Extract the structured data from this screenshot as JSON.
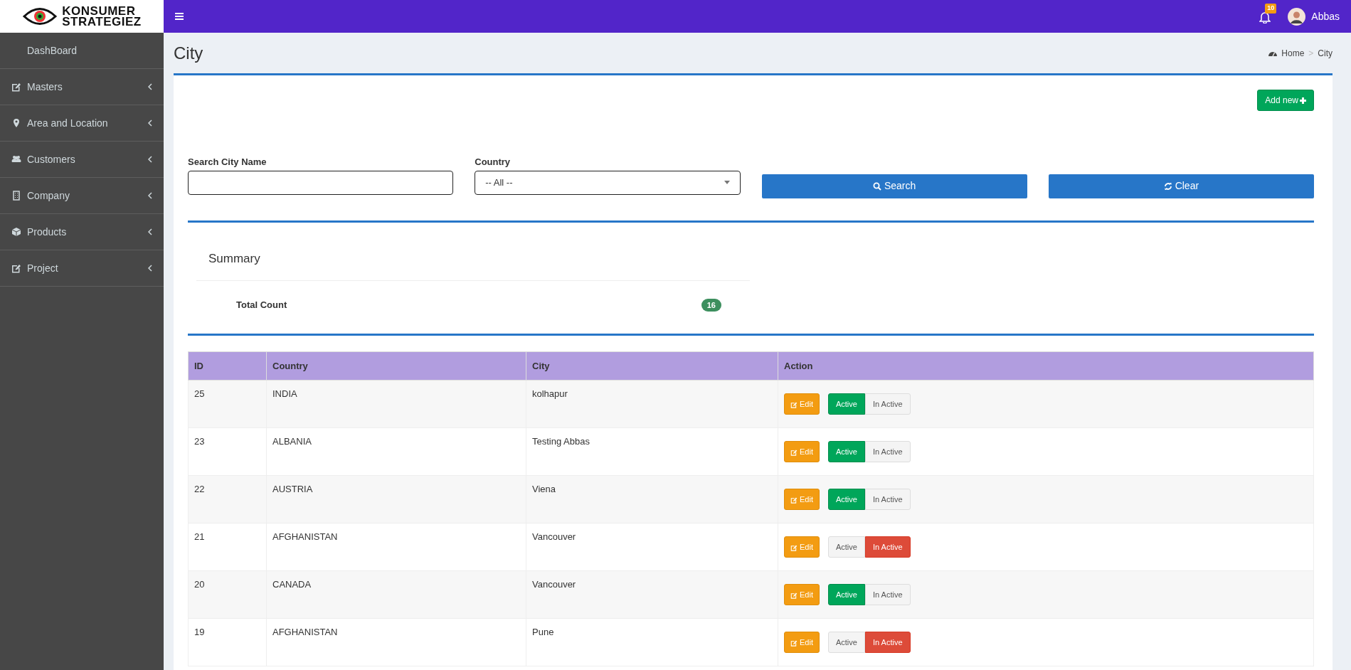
{
  "brand": {
    "line1": "KONSUMER",
    "line2": "STRATEGIEZ"
  },
  "topbar": {
    "notifications": "10",
    "user": "Abbas"
  },
  "sidebar": {
    "items": [
      {
        "label": "DashBoard",
        "has_submenu": false
      },
      {
        "label": "Masters",
        "has_submenu": true
      },
      {
        "label": "Area and Location",
        "has_submenu": true
      },
      {
        "label": "Customers",
        "has_submenu": true
      },
      {
        "label": "Company",
        "has_submenu": true
      },
      {
        "label": "Products",
        "has_submenu": true
      },
      {
        "label": "Project",
        "has_submenu": true
      }
    ]
  },
  "page": {
    "title": "City",
    "breadcrumb": [
      "Home",
      "City"
    ],
    "separator": ">"
  },
  "add_button": "Add new",
  "filters": {
    "city_label": "Search City Name",
    "country_label": "Country",
    "country_value": "-- All --",
    "search_button": "Search",
    "clear_button": "Clear"
  },
  "summary": {
    "title": "Summary",
    "count_label": "Total Count",
    "count": "16"
  },
  "table": {
    "columns": [
      "ID",
      "Country",
      "City",
      "Action"
    ],
    "rows": [
      {
        "id": "25",
        "country": "INDIA",
        "city": "kolhapur",
        "edit": "Edit",
        "active_label": "Active",
        "inactive_label": "In Active",
        "active": true
      },
      {
        "id": "23",
        "country": "ALBANIA",
        "city": "Testing Abbas",
        "edit": "Edit",
        "active_label": "Active",
        "inactive_label": "In Active",
        "active": true
      },
      {
        "id": "22",
        "country": "AUSTRIA",
        "city": "Viena",
        "edit": "Edit",
        "active_label": "Active",
        "inactive_label": "In Active",
        "active": true
      },
      {
        "id": "21",
        "country": "AFGHANISTAN",
        "city": "Vancouver",
        "edit": "Edit",
        "active_label": "Active",
        "inactive_label": "In Active",
        "active": false
      },
      {
        "id": "20",
        "country": "CANADA",
        "city": "Vancouver",
        "edit": "Edit",
        "active_label": "Active",
        "inactive_label": "In Active",
        "active": true
      },
      {
        "id": "19",
        "country": "AFGHANISTAN",
        "city": "Pune",
        "edit": "Edit",
        "active_label": "Active",
        "inactive_label": "In Active",
        "active": false
      }
    ]
  }
}
